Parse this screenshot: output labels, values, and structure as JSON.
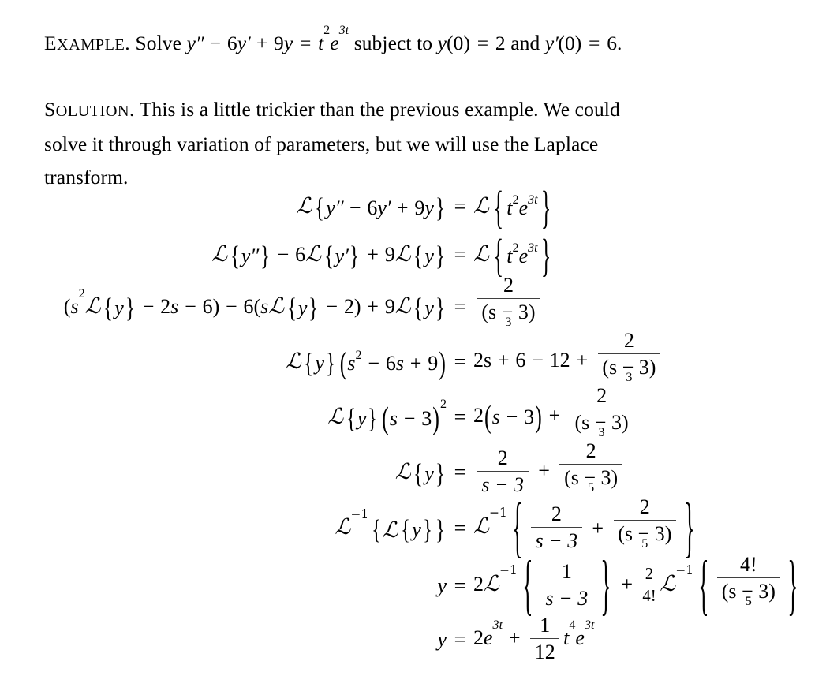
{
  "document": {
    "type": "math-textbook-excerpt",
    "topic": "Solving an initial value problem with the Laplace transform",
    "background_color": "#ffffff",
    "text_color": "#000000",
    "fraction_bar_color": "#3f3f3f"
  },
  "paragraphs": [
    {
      "id": "example",
      "label_first": "E",
      "label_rest": "XAMPLE",
      "label_punct": ".",
      "body_plain": "Solve y′′ − 6y′ + 9y = t²e³ᵗ subject to y(0) = 2 and y′(0) = 6.",
      "tokens": {
        "solve": "Solve",
        "subject_to": "subject to",
        "and": "and",
        "y": "y",
        "t": "t",
        "e": "e",
        "s": "s",
        "prime": "′",
        "dprime": "′′",
        "minus": "−",
        "plus": "+",
        "equals": "=",
        "six": "6",
        "nine": "9",
        "two": "2",
        "three": "3",
        "zero": "0",
        "lparen": "(",
        "rparen": ")",
        "period": "."
      }
    },
    {
      "id": "solution",
      "label_first": "S",
      "label_rest": "OLUTION",
      "label_punct": ".",
      "body": "This is a little trickier than the previous example. We could solve it through variation of parameters, but we will use the Laplace transform."
    }
  ],
  "math_symbols": {
    "script_L": "ℒ",
    "script_L_inverse_exponent": "−1",
    "minus": "−",
    "plus": "+",
    "equals": "=",
    "lbrace": "{",
    "rbrace": "}",
    "lparen": "(",
    "rparen": ")",
    "factorial": "!"
  },
  "equations": [
    {
      "index": 1,
      "latex": "\\mathcal{L}\\{y''-6y'+9y\\} = \\mathcal{L}\\{t^2 e^{3t}\\}",
      "lhs_parts": {
        "y": "y",
        "dprime": "′′",
        "minus": "−",
        "six": "6",
        "prime": "′",
        "plus": "+",
        "nine": "9"
      },
      "rhs_parts": {
        "t": "t",
        "two": "2",
        "e": "e",
        "three_t": "3t"
      }
    },
    {
      "index": 2,
      "latex": "\\mathcal{L}\\{y''\\}-6\\mathcal{L}\\{y'\\}+9\\mathcal{L}\\{y\\} = \\mathcal{L}\\{t^2 e^{3t}\\}",
      "lhs_parts": {
        "y": "y",
        "dprime": "′′",
        "minus": "−",
        "six": "6",
        "prime": "′",
        "plus": "+",
        "nine": "9"
      },
      "rhs_parts": {
        "t": "t",
        "two": "2",
        "e": "e",
        "three_t": "3t"
      }
    },
    {
      "index": 3,
      "latex": "(s^2\\mathcal{L}\\{y\\}-2s-6)-6(s\\mathcal{L}\\{y\\}-2)+9\\mathcal{L}\\{y\\} = \\frac{2}{(s-3)^3}",
      "lhs_parts": {
        "s": "s",
        "sup2": "2",
        "y": "y",
        "two": "2",
        "six": "6",
        "nine": "9",
        "minus": "−",
        "plus": "+"
      },
      "rhs_fraction": {
        "numerator": "2",
        "denominator_base": "(s − 3)",
        "denominator_exponent": "3"
      }
    },
    {
      "index": 4,
      "latex": "\\mathcal{L}\\{y\\}(s^2-6s+9) = 2s+6-12+\\frac{2}{(s-3)^3}",
      "lhs_parts": {
        "y": "y",
        "s": "s",
        "sup2": "2",
        "six": "6",
        "nine": "9"
      },
      "rhs_leading": {
        "two_s": "2s",
        "six": "6",
        "twelve": "12"
      },
      "rhs_fraction": {
        "numerator": "2",
        "denominator_base": "(s − 3)",
        "denominator_exponent": "3"
      }
    },
    {
      "index": 5,
      "latex": "\\mathcal{L}\\{y\\}(s-3)^2 = 2(s-3)+\\frac{2}{(s-3)^3}",
      "lhs_parts": {
        "y": "y",
        "s": "s",
        "three": "3",
        "exp2": "2"
      },
      "rhs_leading": {
        "two": "2",
        "s": "s",
        "three": "3"
      },
      "rhs_fraction": {
        "numerator": "2",
        "denominator_base": "(s − 3)",
        "denominator_exponent": "3"
      }
    },
    {
      "index": 6,
      "latex": "\\mathcal{L}\\{y\\} = \\frac{2}{s-3}+\\frac{2}{(s-3)^5}",
      "lhs_parts": {
        "y": "y"
      },
      "rhs_fraction_1": {
        "numerator": "2",
        "denominator": "s − 3"
      },
      "rhs_fraction_2": {
        "numerator": "2",
        "denominator_base": "(s − 3)",
        "denominator_exponent": "5"
      }
    },
    {
      "index": 7,
      "latex": "\\mathcal{L}^{-1}\\{\\mathcal{L}\\{y\\}\\} = \\mathcal{L}^{-1}\\left\\{\\frac{2}{s-3}+\\frac{2}{(s-3)^5}\\right\\}",
      "lhs_parts": {
        "y": "y",
        "inv": "−1"
      },
      "rhs_fraction_1": {
        "numerator": "2",
        "denominator": "s − 3"
      },
      "rhs_fraction_2": {
        "numerator": "2",
        "denominator_base": "(s − 3)",
        "denominator_exponent": "5"
      }
    },
    {
      "index": 8,
      "latex": "y = 2\\mathcal{L}^{-1}\\left\\{\\frac{1}{s-3}\\right\\}+\\frac{2}{4!}\\mathcal{L}^{-1}\\left\\{\\frac{4!}{(s-3)^5}\\right\\}",
      "lhs_parts": {
        "y": "y"
      },
      "rhs_coefficient": "2",
      "rhs_fraction_1": {
        "numerator": "1",
        "denominator": "s − 3"
      },
      "rhs_coefficient_fraction": {
        "numerator": "2",
        "denominator": "4!"
      },
      "rhs_fraction_2": {
        "numerator": "4!",
        "denominator_base": "(s − 3)",
        "denominator_exponent": "5"
      },
      "inv": "−1"
    },
    {
      "index": 9,
      "latex": "y = 2e^{3t}+\\frac{1}{12}t^4 e^{3t}",
      "lhs_parts": {
        "y": "y"
      },
      "rhs_parts": {
        "two": "2",
        "e": "e",
        "three_t": "3t",
        "t": "t",
        "four": "4"
      },
      "rhs_fraction": {
        "numerator": "1",
        "denominator": "12"
      }
    }
  ]
}
